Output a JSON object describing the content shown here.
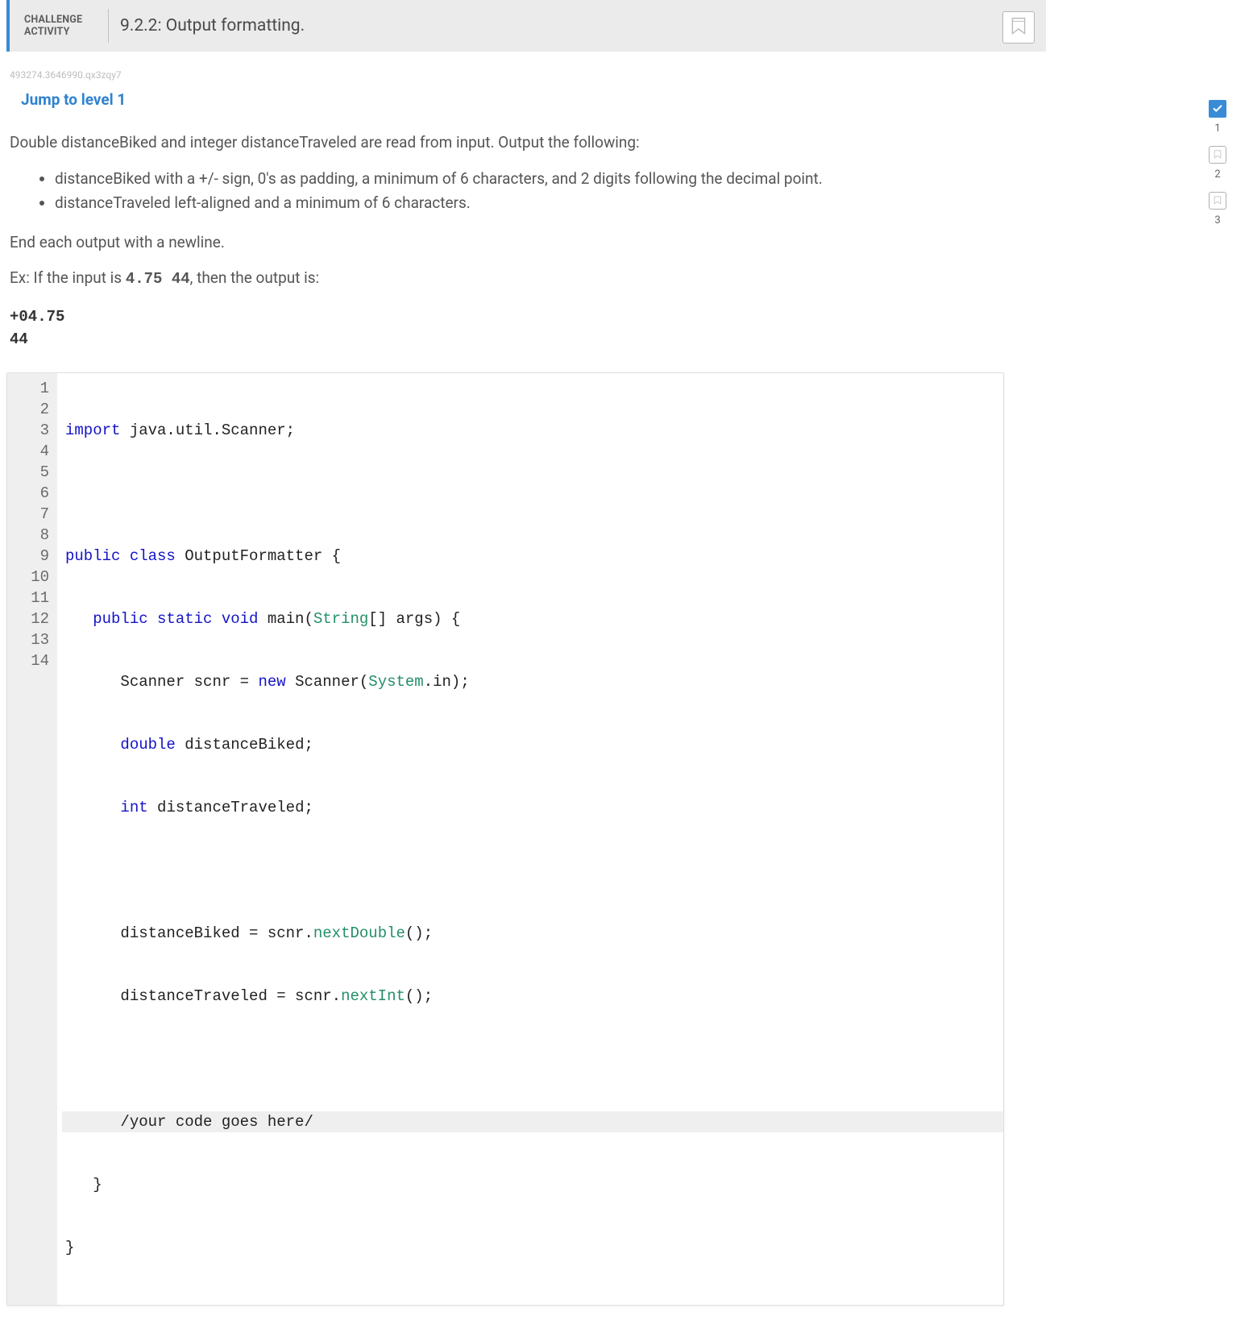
{
  "header": {
    "label": "CHALLENGE ACTIVITY",
    "title": "9.2.2: Output formatting."
  },
  "ident": "493274.3646990.qx3zqy7",
  "jump_link": "Jump to level 1",
  "instructions": {
    "intro": "Double distanceBiked and integer distanceTraveled are read from input. Output the following:",
    "bullet1": "distanceBiked with a +/- sign, 0's as padding, a minimum of 6 characters, and 2 digits following the decimal point.",
    "bullet2": "distanceTraveled left-aligned and a minimum of 6 characters.",
    "end_line": "End each output with a newline.",
    "ex_prefix": "Ex: If the input is ",
    "ex_input": "4.75 44",
    "ex_suffix": ", then the output is:",
    "output": "+04.75\n44"
  },
  "code": {
    "l1_kw": "import",
    "l1_rest": " java.util.Scanner;",
    "l3_kw": "public class",
    "l3_rest": " OutputFormatter {",
    "l4_indent": "   ",
    "l4_kw": "public static void",
    "l4_mid": " main(",
    "l4_type": "String",
    "l4_end": "[] args) {",
    "l5_indent": "      ",
    "l5_a": "Scanner scnr = ",
    "l5_kw": "new",
    "l5_b": " Scanner(",
    "l5_type": "System",
    "l5_c": ".in);",
    "l6_indent": "      ",
    "l6_kw": "double",
    "l6_rest": " distanceBiked;",
    "l7_indent": "      ",
    "l7_kw": "int",
    "l7_rest": " distanceTraveled;",
    "l9_indent": "      ",
    "l9_a": "distanceBiked = scnr.",
    "l9_type": "nextDouble",
    "l9_b": "();",
    "l10_indent": "      ",
    "l10_a": "distanceTraveled = scnr.",
    "l10_type": "nextInt",
    "l10_b": "();",
    "l12_indent": "      ",
    "l12": "/your code goes here/",
    "l13_indent": "   ",
    "l13": "}",
    "l14": "}"
  },
  "steps": {
    "n1": "1",
    "n2": "2",
    "n3": "3"
  }
}
